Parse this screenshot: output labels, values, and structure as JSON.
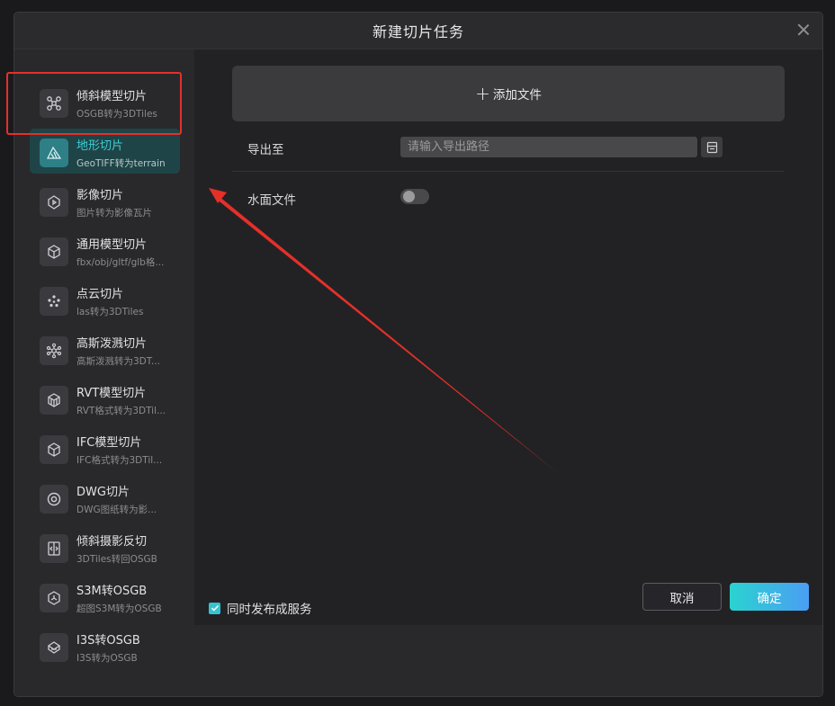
{
  "dialog": {
    "title": "新建切片任务"
  },
  "sidebar": {
    "items": [
      {
        "label": "倾斜模型切片",
        "sub": "OSGB转为3DTiles",
        "icon": "drone-icon"
      },
      {
        "label": "地形切片",
        "sub": "GeoTIFF转为terrain",
        "icon": "terrain-icon",
        "active": true
      },
      {
        "label": "影像切片",
        "sub": "图片转为影像瓦片",
        "icon": "image-icon"
      },
      {
        "label": "通用模型切片",
        "sub": "fbx/obj/gltf/glb格...",
        "icon": "cube-icon"
      },
      {
        "label": "点云切片",
        "sub": "las转为3DTiles",
        "icon": "point-cloud-icon"
      },
      {
        "label": "高斯泼溅切片",
        "sub": "高斯泼溅转为3DT...",
        "icon": "network-icon"
      },
      {
        "label": "RVT模型切片",
        "sub": "RVT格式转为3DTil...",
        "icon": "box-layers-icon"
      },
      {
        "label": "IFC模型切片",
        "sub": "IFC格式转为3DTil...",
        "icon": "cube-outline-icon"
      },
      {
        "label": "DWG切片",
        "sub": "DWG图纸转为影...",
        "icon": "target-icon"
      },
      {
        "label": "倾斜摄影反切",
        "sub": "3DTiles转回OSGB",
        "icon": "reverse-icon"
      },
      {
        "label": "S3M转OSGB",
        "sub": "超图S3M转为OSGB",
        "icon": "hexagon-icon"
      },
      {
        "label": "I3S转OSGB",
        "sub": "I3S转为OSGB",
        "icon": "stack-icon"
      }
    ]
  },
  "main": {
    "add_file_label": "添加文件",
    "export_label": "导出至",
    "export_placeholder": "请输入导出路径",
    "water_label": "水面文件",
    "water_enabled": false
  },
  "footer": {
    "publish_label": "同时发布成服务",
    "publish_checked": true,
    "cancel_label": "取消",
    "ok_label": "确定"
  },
  "colors": {
    "accent": "#38d1d6",
    "annotation": "#e5302a"
  }
}
